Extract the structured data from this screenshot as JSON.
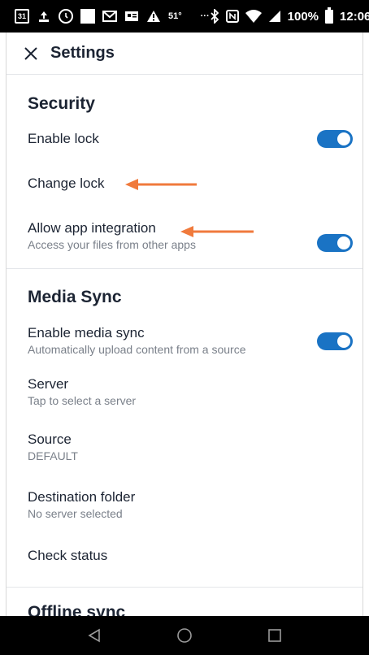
{
  "status_bar": {
    "temperature": "51°",
    "calendar_day": "31",
    "battery": "100%",
    "time": "12:06",
    "more": "···"
  },
  "header": {
    "title": "Settings"
  },
  "security": {
    "heading": "Security",
    "enable_lock": {
      "label": "Enable lock",
      "on": true
    },
    "change_lock": {
      "label": "Change lock"
    },
    "app_integration": {
      "label": "Allow app integration",
      "subtitle": "Access your files from other apps",
      "on": true
    }
  },
  "media_sync": {
    "heading": "Media Sync",
    "enable": {
      "label": "Enable media sync",
      "subtitle": "Automatically upload content from a source",
      "on": true
    },
    "server": {
      "label": "Server",
      "subtitle": "Tap to select a server"
    },
    "source": {
      "label": "Source",
      "subtitle": "DEFAULT"
    },
    "destination": {
      "label": "Destination folder",
      "subtitle": "No server selected"
    },
    "check_status": {
      "label": "Check status"
    }
  },
  "offline_sync": {
    "heading": "Offline sync"
  },
  "colors": {
    "accent": "#1a73c4",
    "annotation_arrow": "#f07a3c",
    "text": "#1c2433",
    "subtext": "#7a808a"
  }
}
